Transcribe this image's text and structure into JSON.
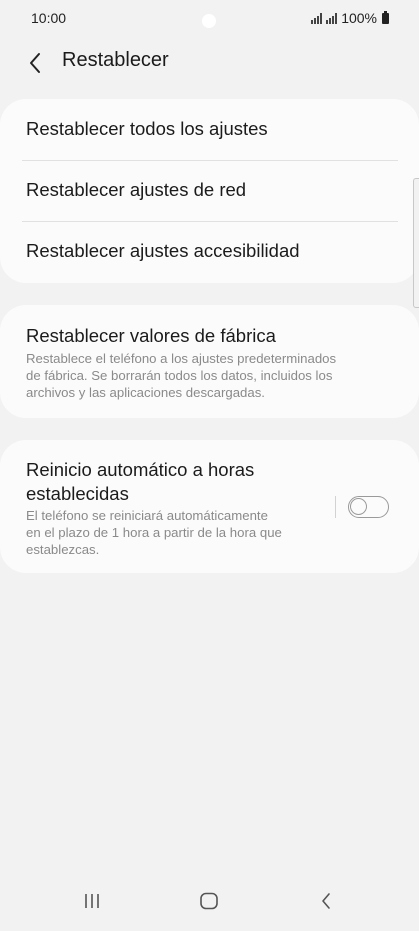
{
  "status_bar": {
    "time": "10:00",
    "battery": "100%"
  },
  "header": {
    "back_icon": "chevron-left-icon",
    "title": "Restablecer"
  },
  "reset_options": [
    {
      "label": "Restablecer todos los ajustes"
    },
    {
      "label": "Restablecer ajustes de red"
    },
    {
      "label": "Restablecer ajustes accesibilidad"
    }
  ],
  "factory_reset": {
    "title": "Restablecer valores de fábrica",
    "description_lines": [
      "Restablece el teléfono a los ajustes predeterminados",
      "de fábrica. Se borrarán todos los datos, incluidos los",
      "archivos y las aplicaciones descargadas."
    ]
  },
  "auto_restart": {
    "title_lines": [
      "Reinicio automático a horas",
      "establecidas"
    ],
    "description_lines": [
      "El teléfono se reiniciará automáticamente",
      "en el plazo de 1 hora a partir de la hora que",
      "establezcas."
    ],
    "toggle_on": false
  },
  "nav_bar": {
    "recents_icon": "recents-icon",
    "home_icon": "home-icon",
    "back_icon": "back-icon"
  },
  "colors": {
    "background": "#f2f2f2",
    "card": "#fbfbfb",
    "text_primary": "#1b1b1b",
    "text_secondary": "#8a8a8a"
  }
}
